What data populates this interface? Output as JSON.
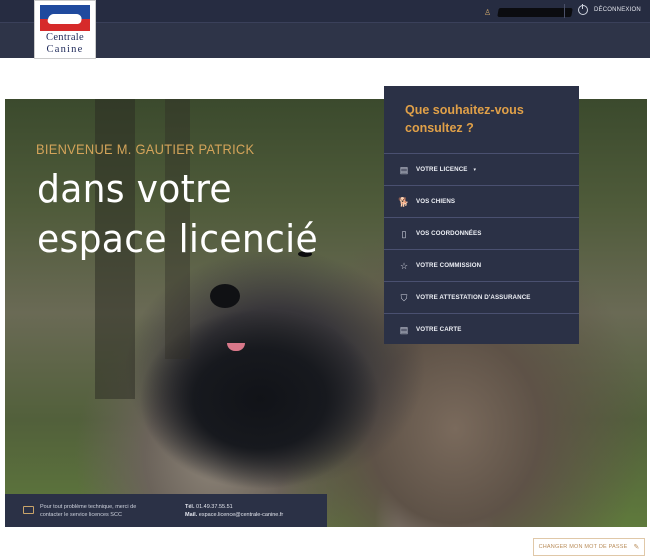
{
  "header": {
    "logo_line1": "Centrale",
    "logo_line2": "Canine",
    "logout_label": "DÉCONNEXION",
    "user_icon": "user-icon",
    "logout_icon": "power-icon"
  },
  "hero": {
    "welcome": "BIENVENUE M. GAUTIER PATRICK",
    "headline": "dans votre espace licencié"
  },
  "menu": {
    "question": "Que souhaitez-vous consultez ?",
    "items": [
      {
        "label": "VOTRE LICENCE",
        "icon": "card-icon",
        "glyph": "▤",
        "caret": "▾"
      },
      {
        "label": "VOS CHIENS",
        "icon": "dog-icon",
        "glyph": "🐕"
      },
      {
        "label": "VOS COORDONNÉES",
        "icon": "document-icon",
        "glyph": "▯"
      },
      {
        "label": "VOTRE COMMISSION",
        "icon": "star-icon",
        "glyph": "☆"
      },
      {
        "label": "VOTRE ATTESTATION D'ASSURANCE",
        "icon": "shield-icon",
        "glyph": "⛉"
      },
      {
        "label": "VOTRE CARTE",
        "icon": "id-card-icon",
        "glyph": "▤"
      }
    ]
  },
  "info": {
    "text": "Pour tout problème technique, merci de contacter le service licences SCC",
    "tel_label": "Tél.",
    "tel_value": "01.49.37.55.51",
    "mail_label": "Mail.",
    "mail_value": "espace.licence@centrale-canine.fr"
  },
  "password_button": {
    "label": "CHANGER MON MOT DE PASSE",
    "icon": "pencil-icon"
  }
}
